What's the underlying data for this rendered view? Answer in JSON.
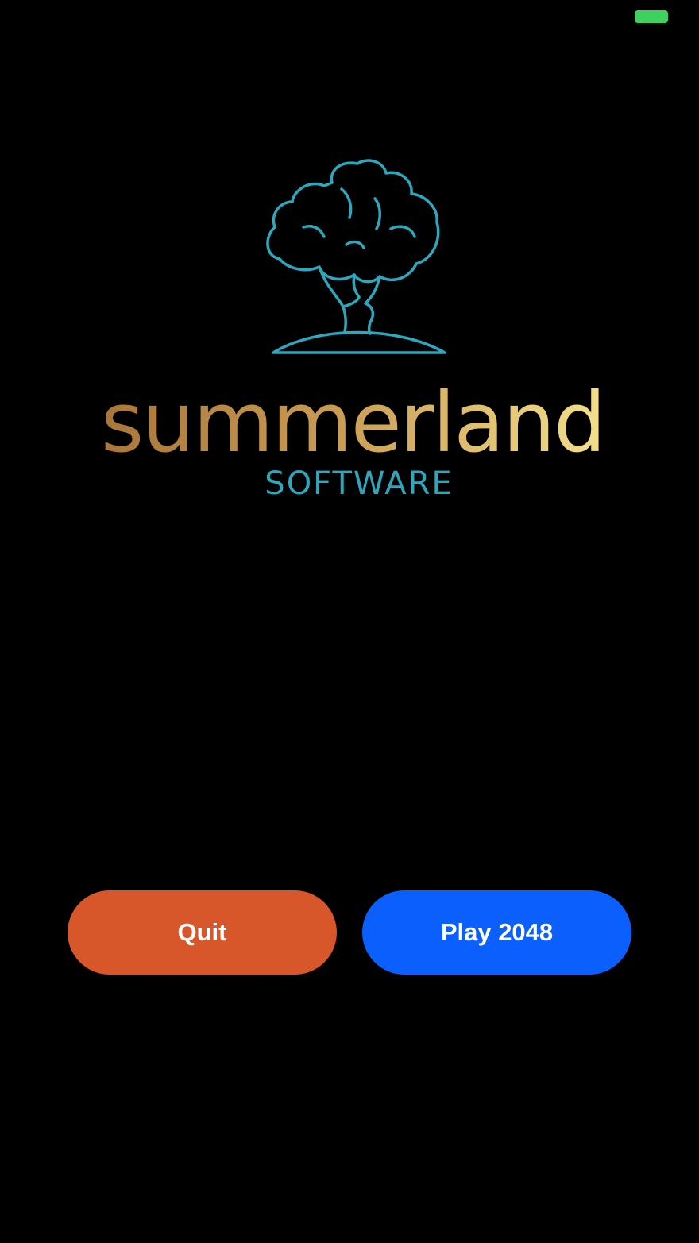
{
  "status": {
    "indicator_color": "#3ed160"
  },
  "logo": {
    "brand_text": "summerland",
    "sub_text": "SOFTWARE",
    "icon": "tree-icon",
    "tree_color": "#2ea7bd",
    "gold_start": "#a8763a",
    "gold_end": "#f3e08c",
    "sub_color": "#2ea7bd"
  },
  "buttons": {
    "quit_label": "Quit",
    "quit_color": "#d7572b",
    "play_label": "Play 2048",
    "play_color": "#0b60fd"
  }
}
